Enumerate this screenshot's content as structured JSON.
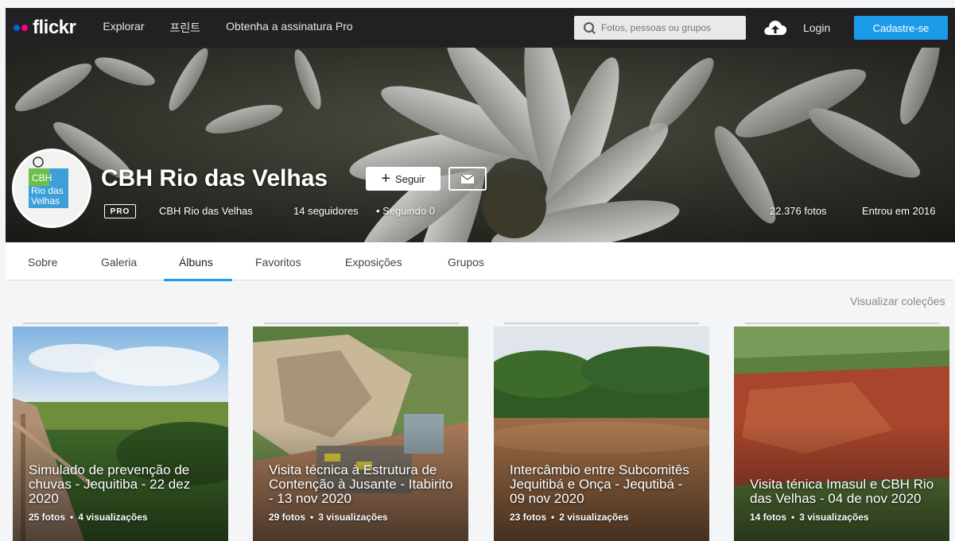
{
  "nav": {
    "logo": "flickr",
    "links": [
      "Explorar",
      "프린트",
      "Obtenha a assinatura Pro"
    ],
    "search_placeholder": "Fotos, pessoas ou grupos",
    "login": "Login",
    "signup": "Cadastre-se"
  },
  "profile": {
    "avatar_lines": [
      "CBH",
      "Rio das",
      "Velhas"
    ],
    "name": "CBH Rio das Velhas",
    "follow_label": "Seguir",
    "pro_badge": "PRO",
    "username": "CBH Rio das Velhas",
    "followers": "14 seguidores",
    "following": "• Seguindo 0",
    "photos": "22.376 fotos",
    "joined": "Entrou em 2016"
  },
  "tabs": [
    "Sobre",
    "Galeria",
    "Álbuns",
    "Favoritos",
    "Exposições",
    "Grupos"
  ],
  "active_tab": "Álbuns",
  "collections_link": "Visualizar coleções",
  "albums": [
    {
      "title": "Simulado de prevenção de chuvas - Jequitiba - 22 dez 2020",
      "photos": "25 fotos",
      "views": "4 visualizações"
    },
    {
      "title": "Visita técnica à Estrutura de Contenção à Jusante - Itabirito - 13 nov 2020",
      "photos": "29 fotos",
      "views": "3 visualizações"
    },
    {
      "title": "Intercâmbio entre Subcomitês Jequitibá e Onça - Jequtibá - 09 nov 2020",
      "photos": "23 fotos",
      "views": "2 visualizações"
    },
    {
      "title": "Visita ténica Imasul e CBH Rio das Velhas - 04 de nov 2020",
      "photos": "14 fotos",
      "views": "3 visualizações"
    }
  ],
  "colors": {
    "navbar": "#212124",
    "accent_blue": "#1c9be9",
    "logo_blue": "#0063dc",
    "logo_pink": "#ff0084"
  }
}
